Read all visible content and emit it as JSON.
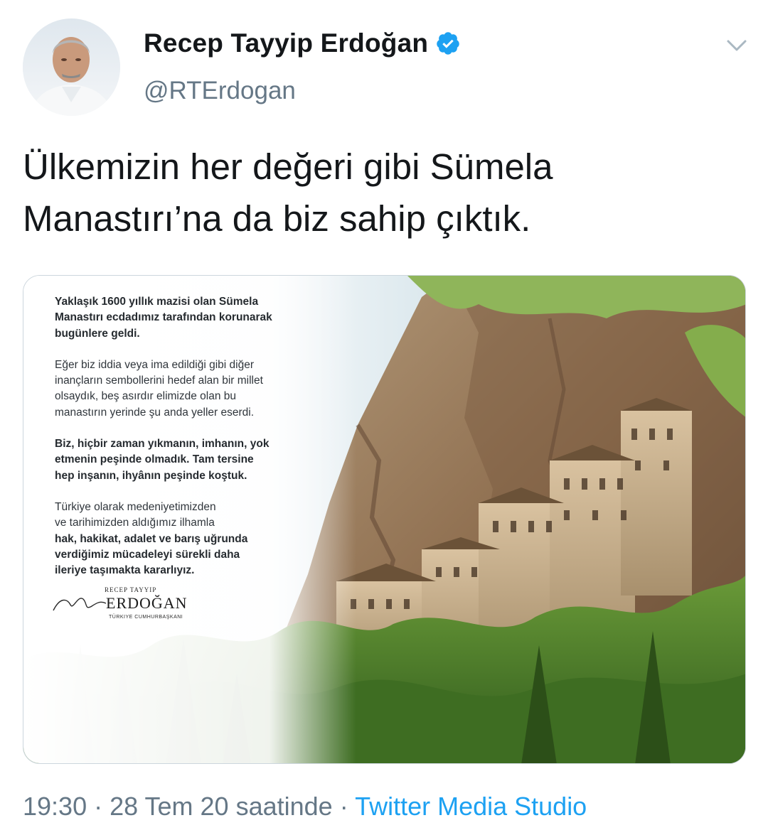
{
  "tweet": {
    "author": {
      "display_name": "Recep Tayyip Erdoğan",
      "handle": "@RTErdogan",
      "verified_icon": "verified-badge-icon",
      "avatar_icon": "profile-photo"
    },
    "menu_icon": "chevron-down-icon",
    "text_line1": "Ülkemizin her değeri gibi Sümela",
    "text_line2": "Manastırı’na da biz sahip çıktık.",
    "media": {
      "statement": {
        "para1": [
          "Yaklaşık 1600 yıllık mazisi olan Sümela",
          "Manastırı ecdadımız tarafından korunarak",
          "bugünlere geldi."
        ],
        "para2": [
          "Eğer biz iddia veya ima edildiği gibi diğer",
          "inançların sembollerini hedef alan bir millet",
          "olsaydık, beş asırdır elimizde olan bu",
          "manastırın yerinde şu anda yeller eserdi."
        ],
        "para3": [
          "Biz, hiçbir zaman yıkmanın, imhanın, yok",
          "etmenin peşinde olmadık. Tam tersine",
          "hep inşanın, ihyânın peşinde koştuk."
        ],
        "para4_regular": [
          "Türkiye olarak medeniyetimizden",
          "ve tarihimizden aldığımız ilhamla"
        ],
        "para4_bold": [
          "hak, hakikat, adalet ve barış uğrunda",
          "verdiğimiz mücadeleyi sürekli daha",
          "ileriye taşımakta kararlıyız."
        ]
      },
      "signature": {
        "first_names": "RECEP TAYYIP",
        "surname": "ERDOĞAN",
        "title": "TÜRKIYE CUMHURBAŞKANI"
      }
    },
    "time": "19:30",
    "separator": "·",
    "date": "28 Tem 20 saatinde",
    "source": "Twitter Media Studio"
  },
  "colors": {
    "text_primary": "#14171a",
    "text_secondary": "#657786",
    "link": "#1da1f2",
    "verified": "#1da1f2"
  }
}
